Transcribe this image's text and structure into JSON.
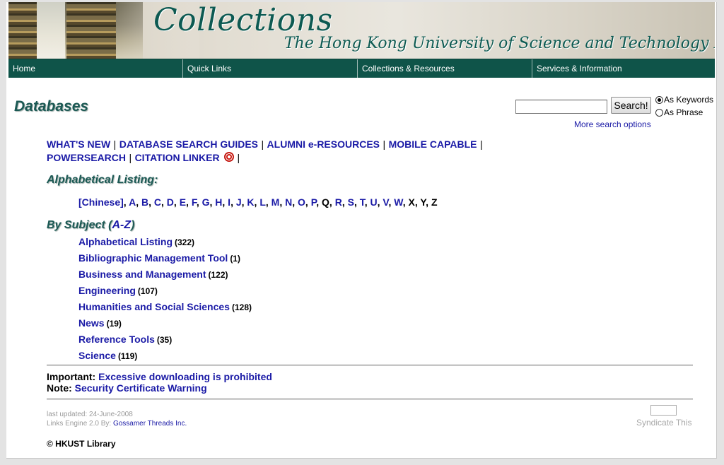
{
  "banner": {
    "title": "Collections",
    "subtitle": "The Hong Kong University of Science and Technology Library"
  },
  "nav": {
    "items": [
      {
        "label": "Home"
      },
      {
        "label": "Quick Links"
      },
      {
        "label": "Collections & Resources"
      },
      {
        "label": "Services & Information"
      }
    ]
  },
  "page": {
    "title": "Databases"
  },
  "search": {
    "value": "",
    "button_label": "Search!",
    "options": [
      {
        "label": "As Keywords",
        "checked": true
      },
      {
        "label": "As Phrase",
        "checked": false
      }
    ],
    "more_options": "More search options"
  },
  "top_links": {
    "whats_new": "WHAT'S NEW",
    "search_guides": "DATABASE SEARCH GUIDES",
    "alumni": "ALUMNI e-RESOURCES",
    "mobile": "MOBILE CAPABLE",
    "powersearch": "POWERSEARCH",
    "citation": "CITATION LINKER",
    "separator": "|"
  },
  "alphabetical": {
    "heading": "Alphabetical Listing:",
    "letters": [
      {
        "label": "[Chinese]",
        "active": true
      },
      {
        "label": "A",
        "active": true
      },
      {
        "label": "B",
        "active": true
      },
      {
        "label": "C",
        "active": true
      },
      {
        "label": "D",
        "active": true
      },
      {
        "label": "E",
        "active": true
      },
      {
        "label": "F",
        "active": true
      },
      {
        "label": "G",
        "active": true
      },
      {
        "label": "H",
        "active": true
      },
      {
        "label": "I",
        "active": true
      },
      {
        "label": "J",
        "active": true
      },
      {
        "label": "K",
        "active": true
      },
      {
        "label": "L",
        "active": true
      },
      {
        "label": "M",
        "active": true
      },
      {
        "label": "N",
        "active": true
      },
      {
        "label": "O",
        "active": true
      },
      {
        "label": "P",
        "active": true
      },
      {
        "label": "Q",
        "active": false
      },
      {
        "label": "R",
        "active": true
      },
      {
        "label": "S",
        "active": true
      },
      {
        "label": "T",
        "active": true
      },
      {
        "label": "U",
        "active": true
      },
      {
        "label": "V",
        "active": true
      },
      {
        "label": "W",
        "active": true
      },
      {
        "label": "X",
        "active": false
      },
      {
        "label": "Y",
        "active": false
      },
      {
        "label": "Z",
        "active": false
      }
    ]
  },
  "subjects": {
    "heading": "By Subject (",
    "az_link": "A-Z",
    "heading_close": ")",
    "items": [
      {
        "label": "Alphabetical Listing",
        "count": "(322)"
      },
      {
        "label": "Bibliographic Management Tool",
        "count": "(1)"
      },
      {
        "label": "Business and Management",
        "count": "(122)"
      },
      {
        "label": "Engineering",
        "count": "(107)"
      },
      {
        "label": "Humanities and Social Sciences",
        "count": "(128)"
      },
      {
        "label": "News",
        "count": "(19)"
      },
      {
        "label": "Reference Tools",
        "count": "(35)"
      },
      {
        "label": "Science",
        "count": "(119)"
      }
    ]
  },
  "notices": {
    "important_label": "Important:",
    "important_link": "Excessive downloading is prohibited",
    "note_label": "Note:",
    "note_link": "Security Certificate Warning"
  },
  "footer": {
    "last_updated": "last updated: 24-June-2008",
    "engine_prefix": "Links Engine 2.0 By:",
    "engine_link": "Gossamer Threads Inc.",
    "syndicate": "Syndicate This",
    "copyright": "© HKUST Library"
  },
  "colors": {
    "nav_bg": "#0f5449",
    "heading": "#1b5954",
    "link": "#1a1aa6"
  }
}
